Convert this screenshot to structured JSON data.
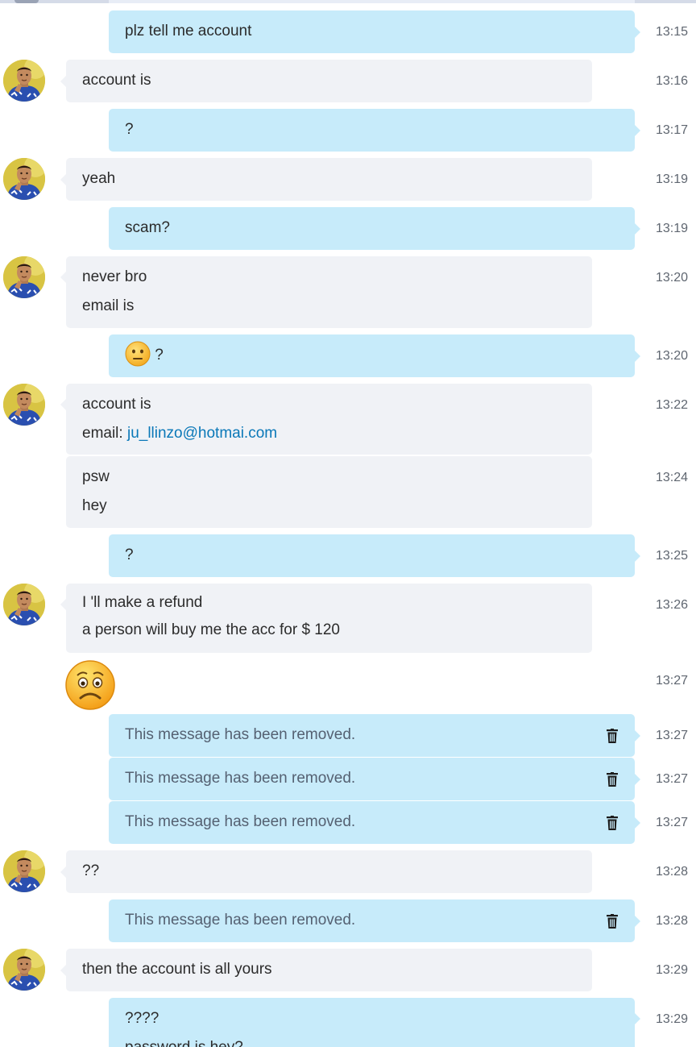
{
  "messages": [
    {
      "text": "plz tell me account",
      "time": "13:15"
    },
    {
      "text": "account is",
      "time": "13:16"
    },
    {
      "text": "?",
      "time": "13:17"
    },
    {
      "text": "yeah",
      "time": "13:19"
    },
    {
      "text": "scam?",
      "time": "13:19"
    },
    {
      "lines": [
        "never bro",
        "email is"
      ],
      "time": "13:20"
    },
    {
      "text": "?",
      "time": "13:20",
      "emoji": "neutral-face"
    },
    {
      "line1": "account is",
      "email_prefix": "email: ",
      "email_link": "ju_llinzo@hotmai.com",
      "time": "13:22"
    },
    {
      "lines": [
        "psw",
        "hey"
      ],
      "time": "13:24"
    },
    {
      "text": "?",
      "time": "13:25"
    },
    {
      "lines": [
        "I 'll make a refund",
        "a person will buy me the acc for $ 120"
      ],
      "time": "13:26"
    },
    {
      "emoji": "worried-face",
      "time": "13:27"
    },
    {
      "text": "This message has been removed.",
      "time": "13:27"
    },
    {
      "text": "This message has been removed.",
      "time": "13:27"
    },
    {
      "text": "This message has been removed.",
      "time": "13:27"
    },
    {
      "text": "??",
      "time": "13:28"
    },
    {
      "text": "This message has been removed.",
      "time": "13:28"
    },
    {
      "text": "then the account is all yours",
      "time": "13:29"
    },
    {
      "lines": [
        "????",
        "password is hey?"
      ],
      "time": "13:29"
    }
  ],
  "colors": {
    "outgoing_bubble": "#c7ebfa",
    "incoming_bubble": "#f0f2f6",
    "link": "#0a78b8"
  },
  "icons": {
    "delete": "trash-icon",
    "avatar": "contact-avatar"
  }
}
